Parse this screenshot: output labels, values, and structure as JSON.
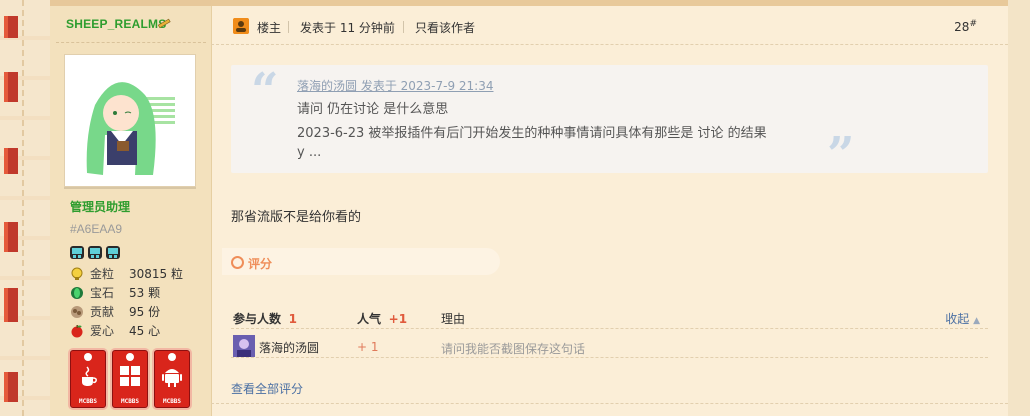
{
  "sidebar": {
    "author_name": "SHEEP_REALMS",
    "group_title": "管理员助理",
    "user_code": "#A6EAA9",
    "medal_icons": [
      "creeper-medal-icon",
      "creeper-medal-icon",
      "creeper-medal-icon"
    ],
    "stats": [
      {
        "icon": "gold-nugget-icon",
        "label": "金粒",
        "value": "30815 粒"
      },
      {
        "icon": "emerald-icon",
        "label": "宝石",
        "value": "53 颗"
      },
      {
        "icon": "contribution-icon",
        "label": "贡献",
        "value": "95 份"
      },
      {
        "icon": "apple-heart-icon",
        "label": "爱心",
        "value": "45 心"
      }
    ],
    "badges": [
      {
        "icon": "java-badge-icon",
        "caption": "MCBBS"
      },
      {
        "icon": "windows-badge-icon",
        "caption": "MCBBS"
      },
      {
        "icon": "android-badge-icon",
        "caption": "MCBBS"
      }
    ]
  },
  "post": {
    "host_label": "楼主",
    "posted": "发表于 11 分钟前",
    "author_only": "只看该作者",
    "floor": "28",
    "floor_suffix": "#",
    "quote": {
      "author": "落海的汤圆 发表于 2023-7-9 21:34",
      "lines": [
        "请问 仍在讨论 是什么意思",
        "2023-6-23 被举报插件有后门开始发生的种种事情请问具体有那些是 讨论 的结果",
        "y ..."
      ]
    },
    "reply": "那省流版不是给你看的"
  },
  "rating": {
    "tab_label": "评分",
    "headers": {
      "participants": "参与人数",
      "participants_count": "1",
      "popularity": "人气",
      "popularity_count": "+1",
      "reason": "理由",
      "collapse": "收起"
    },
    "rows": [
      {
        "user": "落海的汤圆",
        "score": "+ 1",
        "reason": "请问我能否截图保存这句话"
      }
    ],
    "view_all": "查看全部评分"
  },
  "colors": {
    "accent_green": "#2e9d2e",
    "rating_orange": "#ef8e59",
    "link_blue": "#4a6fa3"
  }
}
